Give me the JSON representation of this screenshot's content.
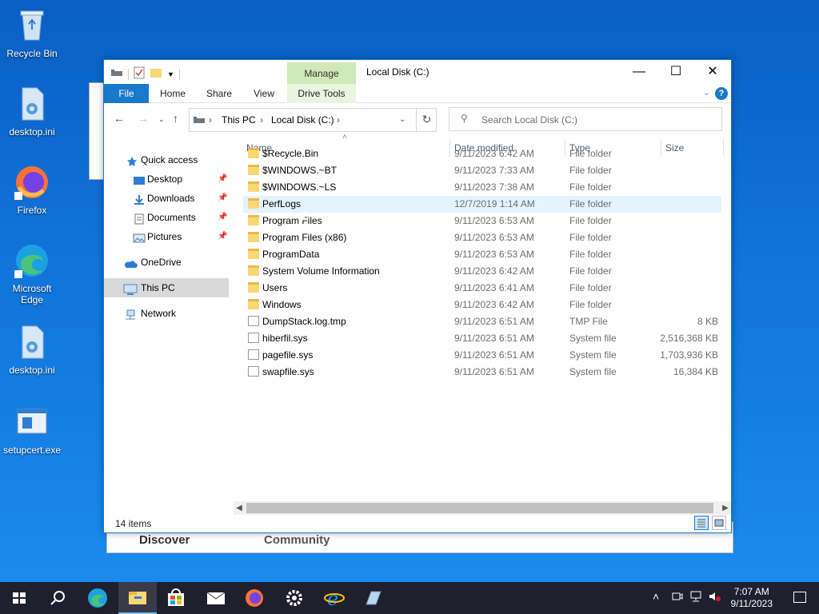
{
  "desktop": {
    "icons": [
      {
        "label": "Recycle Bin"
      },
      {
        "label": "desktop.ini"
      },
      {
        "label": "Firefox"
      },
      {
        "label": "Microsoft Edge"
      },
      {
        "label": "desktop.ini"
      },
      {
        "label": "setupcert.exe"
      }
    ],
    "back_window": {
      "tab1": "Discover",
      "tab2": "Community"
    }
  },
  "window": {
    "title": "Local Disk (C:)",
    "manage_tab": "Manage",
    "ribbon_tabs": [
      "File",
      "Home",
      "Share",
      "View",
      "Drive Tools"
    ],
    "help": "?",
    "breadcrumb": [
      "This PC",
      "Local Disk (C:)"
    ],
    "search_placeholder": "Search Local Disk (C:)",
    "nav": {
      "quick_access": "Quick access",
      "items": [
        "Desktop",
        "Downloads",
        "Documents",
        "Pictures"
      ],
      "onedrive": "OneDrive",
      "this_pc": "This PC",
      "network": "Network"
    },
    "columns": [
      "Name",
      "Date modified",
      "Type",
      "Size"
    ],
    "files": [
      {
        "name": "$Recycle.Bin",
        "date": "9/11/2023 6:42 AM",
        "type": "File folder",
        "size": "",
        "kind": "folder"
      },
      {
        "name": "$WINDOWS.~BT",
        "date": "9/11/2023 7:33 AM",
        "type": "File folder",
        "size": "",
        "kind": "folder"
      },
      {
        "name": "$WINDOWS.~LS",
        "date": "9/11/2023 7:38 AM",
        "type": "File folder",
        "size": "",
        "kind": "folder"
      },
      {
        "name": "PerfLogs",
        "date": "12/7/2019 1:14 AM",
        "type": "File folder",
        "size": "",
        "kind": "folder"
      },
      {
        "name": "Program Files",
        "date": "9/11/2023 6:53 AM",
        "type": "File folder",
        "size": "",
        "kind": "folder"
      },
      {
        "name": "Program Files (x86)",
        "date": "9/11/2023 6:53 AM",
        "type": "File folder",
        "size": "",
        "kind": "folder"
      },
      {
        "name": "ProgramData",
        "date": "9/11/2023 6:53 AM",
        "type": "File folder",
        "size": "",
        "kind": "folder"
      },
      {
        "name": "System Volume Information",
        "date": "9/11/2023 6:42 AM",
        "type": "File folder",
        "size": "",
        "kind": "folder"
      },
      {
        "name": "Users",
        "date": "9/11/2023 6:41 AM",
        "type": "File folder",
        "size": "",
        "kind": "folder"
      },
      {
        "name": "Windows",
        "date": "9/11/2023 6:42 AM",
        "type": "File folder",
        "size": "",
        "kind": "folder"
      },
      {
        "name": "DumpStack.log.tmp",
        "date": "9/11/2023 6:51 AM",
        "type": "TMP File",
        "size": "8 KB",
        "kind": "file"
      },
      {
        "name": "hiberfil.sys",
        "date": "9/11/2023 6:51 AM",
        "type": "System file",
        "size": "2,516,368 KB",
        "kind": "file"
      },
      {
        "name": "pagefile.sys",
        "date": "9/11/2023 6:51 AM",
        "type": "System file",
        "size": "1,703,936 KB",
        "kind": "file"
      },
      {
        "name": "swapfile.sys",
        "date": "9/11/2023 6:51 AM",
        "type": "System file",
        "size": "16,384 KB",
        "kind": "file"
      }
    ],
    "status": "14 items"
  },
  "taskbar": {
    "time": "7:07 AM",
    "date": "9/11/2023"
  },
  "colors": {
    "accent": "#1979ca",
    "manage": "#cfeab8",
    "desktop": "#0a62c7"
  }
}
